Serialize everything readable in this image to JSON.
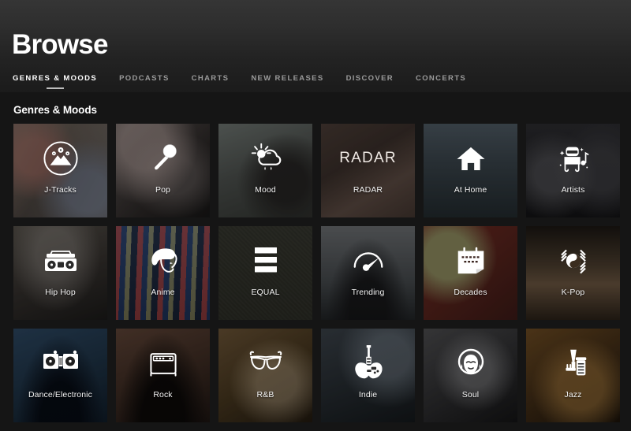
{
  "header": {
    "title": "Browse",
    "nav": [
      {
        "label": "GENRES & MOODS",
        "active": true
      },
      {
        "label": "PODCASTS",
        "active": false
      },
      {
        "label": "CHARTS",
        "active": false
      },
      {
        "label": "NEW RELEASES",
        "active": false
      },
      {
        "label": "DISCOVER",
        "active": false
      },
      {
        "label": "CONCERTS",
        "active": false
      }
    ]
  },
  "main": {
    "section_title": "Genres & Moods",
    "tiles": [
      {
        "label": "J-Tracks",
        "icon": "mount-fuji-circle-icon",
        "art": "art-jtracks"
      },
      {
        "label": "Pop",
        "icon": "microphone-icon",
        "art": "art-pop"
      },
      {
        "label": "Mood",
        "icon": "sun-cloud-rain-icon",
        "art": "art-mood"
      },
      {
        "label": "RADAR",
        "icon": "radar-wordmark",
        "art": "art-radar",
        "logo_text": "RADAR"
      },
      {
        "label": "At Home",
        "icon": "house-icon",
        "art": "art-athome"
      },
      {
        "label": "Artists",
        "icon": "artist-person-icon",
        "art": "art-artists"
      },
      {
        "label": "Hip Hop",
        "icon": "boombox-icon",
        "art": "art-hiphop"
      },
      {
        "label": "Anime",
        "icon": "anime-girl-icon",
        "art": "art-anime"
      },
      {
        "label": "EQUAL",
        "icon": "equal-bars-icon",
        "art": "art-equal"
      },
      {
        "label": "Trending",
        "icon": "gauge-icon",
        "art": "art-trending"
      },
      {
        "label": "Decades",
        "icon": "calendar-icon",
        "art": "art-decades"
      },
      {
        "label": "K-Pop",
        "icon": "taegeuk-trigram-icon",
        "art": "art-kpop"
      },
      {
        "label": "Dance/Electronic",
        "icon": "turntables-icon",
        "art": "art-dance"
      },
      {
        "label": "Rock",
        "icon": "guitar-amp-icon",
        "art": "art-rock"
      },
      {
        "label": "R&B",
        "icon": "sunglasses-icon",
        "art": "art-rnb"
      },
      {
        "label": "Indie",
        "icon": "electric-guitar-icon",
        "art": "art-indie"
      },
      {
        "label": "Soul",
        "icon": "afro-woman-icon",
        "art": "art-soul"
      },
      {
        "label": "Jazz",
        "icon": "trumpet-icon",
        "art": "art-jazz"
      }
    ]
  },
  "colors": {
    "background": "#151515",
    "header_top": "#353535",
    "header_bottom": "#1b1b1b",
    "text_primary": "#ffffff",
    "text_muted": "#9a9a9a",
    "nav_underline": "#bdbdbd"
  }
}
